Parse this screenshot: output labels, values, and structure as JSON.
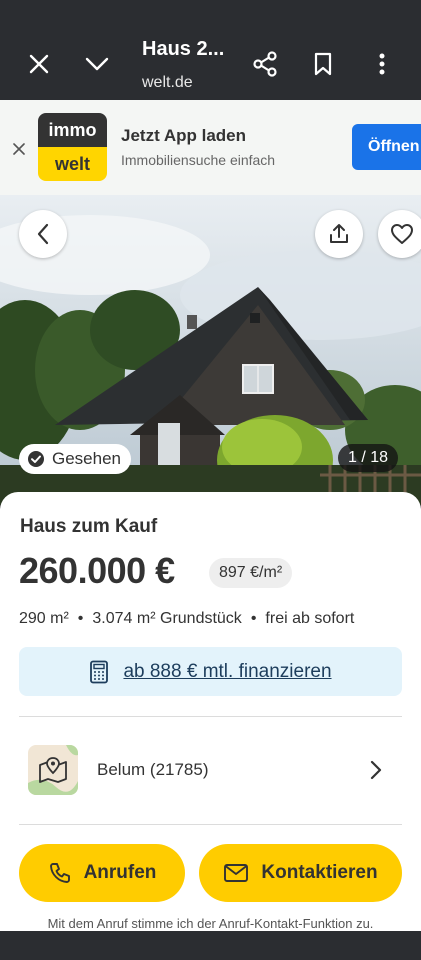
{
  "browser": {
    "title": "Haus 2...",
    "url": "welt.de",
    "icons": [
      "close-icon",
      "chevron-down-icon",
      "share-icon",
      "bookmark-icon",
      "more-vert-icon"
    ]
  },
  "banner": {
    "logo_top": "immo",
    "logo_bottom": "welt",
    "title": "Jetzt App laden",
    "subtitle": "Immobiliensuche einfach",
    "open_label": "Öffnen"
  },
  "gallery": {
    "seen_label": "Gesehen",
    "counter": "1 / 18"
  },
  "listing": {
    "type": "Haus zum Kauf",
    "price": "260.000 €",
    "price_per_sqm": "897 €/m²",
    "facts": [
      "290 m²",
      "3.074 m² Grundstück",
      "frei ab sofort"
    ],
    "fact_separator": "•",
    "finance_label": "ab 888 € mtl. finanzieren",
    "location": "Belum (21785)"
  },
  "actions": {
    "call_label": "Anrufen",
    "contact_label": "Kontaktieren"
  },
  "disclaimer": "Mit dem Anruf stimme ich der Anruf-Kontakt-Funktion zu.",
  "colors": {
    "accent_yellow": "#ffcc00",
    "finance_bg": "#e3f3fb",
    "open_button": "#1a73e8",
    "chrome": "#2b2d31"
  }
}
